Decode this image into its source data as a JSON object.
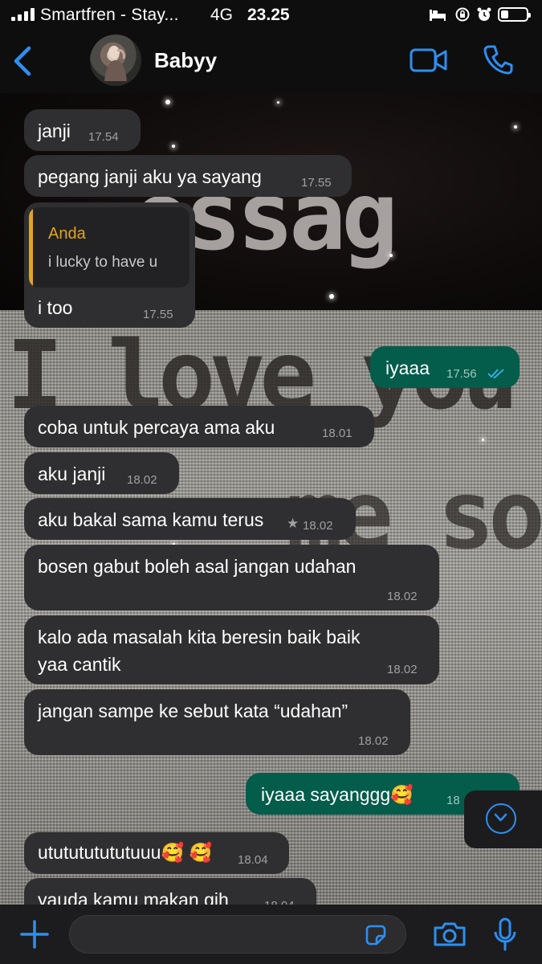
{
  "status_bar": {
    "carrier": "Smartfren - Stay...",
    "network": "4G",
    "time": "23.25"
  },
  "header": {
    "contact_name": "Babyy"
  },
  "wallpaper_text": [
    "essag",
    "I love you",
    "me so"
  ],
  "messages": [
    {
      "dir": "in",
      "text": "janji",
      "time": "17.54"
    },
    {
      "dir": "in",
      "text": "pegang janji aku ya sayang",
      "time": "17.55"
    },
    {
      "dir": "in",
      "reply_to": {
        "name": "Anda",
        "text": "i lucky to have u"
      },
      "text": "i too",
      "time": "17.55"
    },
    {
      "dir": "out",
      "text": "iyaaa",
      "time": "17.56",
      "status": "read"
    },
    {
      "dir": "in",
      "text": "coba untuk percaya ama aku",
      "time": "18.01"
    },
    {
      "dir": "in",
      "text": "aku janji",
      "time": "18.02"
    },
    {
      "dir": "in",
      "text": "aku bakal sama kamu terus",
      "time": "18.02",
      "starred": true
    },
    {
      "dir": "in",
      "text": "bosen gabut boleh asal jangan udahan",
      "time": "18.02"
    },
    {
      "dir": "in",
      "lines": [
        "kalo ada masalah kita beresin baik baik",
        "yaa cantik"
      ],
      "time": "18.02"
    },
    {
      "dir": "in",
      "text": "jangan sampe ke sebut kata “udahan”",
      "time": "18.02"
    },
    {
      "dir": "out",
      "text": "iyaaa sayanggg🥰",
      "time": "18"
    },
    {
      "dir": "in",
      "text": "ututututututuuu🥰 🥰",
      "time": "18.04"
    },
    {
      "dir": "in",
      "text": "yauda kamu makan gih",
      "time": "18.04"
    }
  ],
  "composer": {
    "placeholder": ""
  },
  "colors": {
    "accent": "#2d8ff0",
    "incoming_bubble": "#2f2f31",
    "outgoing_bubble": "#045c4b",
    "quote_bar": "#e2a51c"
  },
  "icons": [
    "back-chevron-icon",
    "video-call-icon",
    "voice-call-icon",
    "plus-icon",
    "sticker-icon",
    "camera-icon",
    "microphone-icon",
    "scroll-down-icon",
    "double-check-icon",
    "star-icon"
  ]
}
